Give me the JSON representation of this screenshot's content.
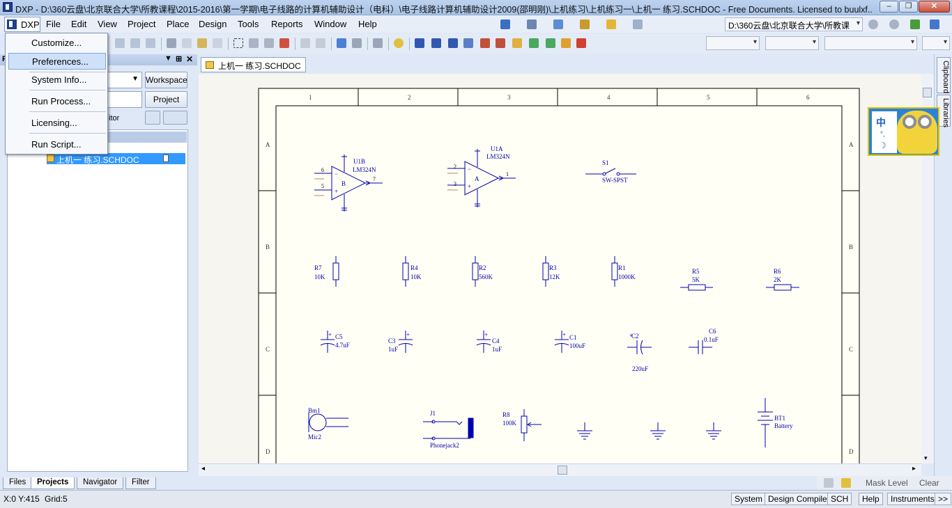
{
  "window": {
    "title": "DXP - D:\\360云盘\\北京联合大学\\所教课程\\2015-2016\\第一学期\\电子线路的计算机辅助设计（电科）\\电子线路计算机辅助设计2009(邵明刚)\\上机练习\\上机练习一\\上机一 练习.SCHDOC - Free Documents. Licensed to buulxf...",
    "minimize": "–",
    "maximize": "❐",
    "close": "✕"
  },
  "menubar": {
    "dxp": "DXP",
    "items": [
      "File",
      "Edit",
      "View",
      "Project",
      "Place",
      "Design",
      "Tools",
      "Reports",
      "Window",
      "Help"
    ],
    "path_combo": "D:\\360云盘\\北京联合大学\\所教课"
  },
  "dxp_menu": {
    "items": [
      "Customize...",
      "Preferences...",
      "System Info...",
      "Run Process...",
      "Licensing...",
      "Run Script..."
    ],
    "highlighted": "Preferences..."
  },
  "left_panel": {
    "header": "P",
    "workspace_btn": "Workspace",
    "project_btn": "Project",
    "partial_label": "itor",
    "tree_selected": "上机一 练习.SCHDOC",
    "tabs": [
      "Files",
      "Projects",
      "Navigator",
      "Filter"
    ],
    "active_tab": "Projects"
  },
  "doc_tab": "上机一 练习.SCHDOC",
  "right_tabs": [
    "Clipboard",
    "Libraries"
  ],
  "ime": {
    "char": "中"
  },
  "schematic": {
    "columns": [
      "1",
      "2",
      "3",
      "4",
      "5",
      "6"
    ],
    "rows": [
      "A",
      "B",
      "C",
      "D"
    ],
    "opamps": [
      {
        "ref": "U1B",
        "part": "LM324N",
        "unit": "B",
        "pin_minus": "6",
        "pin_plus": "5",
        "pin_out": "7"
      },
      {
        "ref": "U1A",
        "part": "LM324N",
        "unit": "A",
        "pin_minus": "2",
        "pin_plus": "3",
        "pin_out": "1"
      }
    ],
    "switch": {
      "ref": "S1",
      "value": "SW-SPST"
    },
    "resistors": [
      {
        "ref": "R7",
        "value": "10K"
      },
      {
        "ref": "R4",
        "value": "10K"
      },
      {
        "ref": "R2",
        "value": "560K"
      },
      {
        "ref": "R3",
        "value": "12K"
      },
      {
        "ref": "R1",
        "value": "1000K"
      },
      {
        "ref": "R5",
        "value": "5K"
      },
      {
        "ref": "R6",
        "value": "2K"
      }
    ],
    "capacitors": [
      {
        "ref": "C5",
        "value": "4.7uF"
      },
      {
        "ref": "C3",
        "value": "1uF"
      },
      {
        "ref": "C4",
        "value": "1uF"
      },
      {
        "ref": "C1",
        "value": "100uF"
      },
      {
        "ref": "C2",
        "value": "220uF"
      },
      {
        "ref": "C6",
        "value": "0.1uF"
      }
    ],
    "mic": {
      "ref": "Bm1",
      "value": "Mic2"
    },
    "jack": {
      "ref": "J1",
      "value": "Phonejack2"
    },
    "pot": {
      "ref": "R8",
      "value": "100K"
    },
    "battery": {
      "ref": "BT1",
      "value": "Battery"
    }
  },
  "mask_bar": {
    "mask_level": "Mask Level",
    "clear": "Clear"
  },
  "status": {
    "coords": "X:0 Y:415",
    "grid": "Grid:5",
    "tabs": [
      "System",
      "Design Compiler",
      "SCH",
      "Help",
      "Instruments"
    ],
    "more": ">>"
  }
}
